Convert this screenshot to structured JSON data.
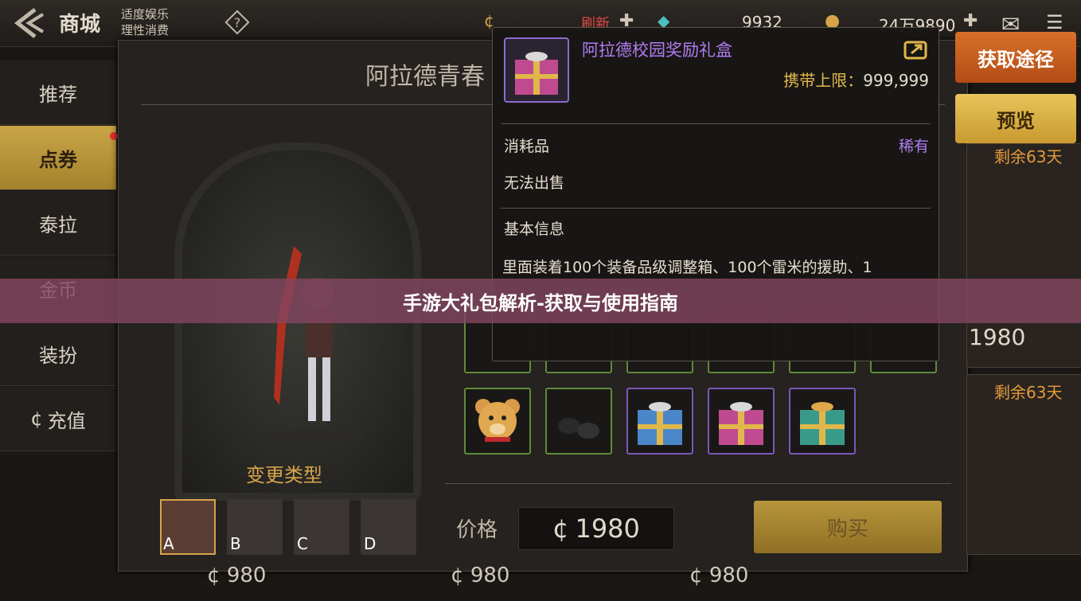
{
  "header": {
    "title": "商城",
    "slogan_line1": "适度娱乐",
    "slogan_line2": "理性消费",
    "refresh_label": "刷新",
    "currency_1": "9932",
    "currency_2": "24万9890"
  },
  "sidebar": {
    "items": [
      {
        "label": "推荐"
      },
      {
        "label": "点券"
      },
      {
        "label": "泰拉"
      },
      {
        "label": "金币"
      },
      {
        "label": "装扮"
      },
      {
        "label": "充值"
      }
    ]
  },
  "panel": {
    "title": "阿拉德青春",
    "change_type_label": "变更类型",
    "character_variants": [
      "A",
      "B",
      "C",
      "D"
    ],
    "price_label": "价格",
    "price_value": "1980",
    "buy_label": "购买",
    "bottom_prices": [
      "980",
      "980",
      "980"
    ]
  },
  "right_strip": {
    "remain_1": "剩余63天",
    "price_1": "1980",
    "remain_2": "剩余63天"
  },
  "tooltip": {
    "name": "阿拉德校园奖励礼盒",
    "carry_limit_label": "携带上限：",
    "carry_limit_value": "999,999",
    "category": "消耗品",
    "rarity": "稀有",
    "sell_status": "无法出售",
    "basic_info_label": "基本信息",
    "description": "里面装着100个装备品级调整箱、100个雷米的援助、1"
  },
  "actions": {
    "get_label": "获取途径",
    "preview_label": "预览"
  },
  "banner": {
    "text": "手游大礼包解析-获取与使用指南"
  },
  "colors": {
    "accent_gold": "#d7a44a",
    "rarity_purple": "#b07cf0",
    "get_button_orange": "#c85c1e",
    "banner": "#82465f"
  }
}
